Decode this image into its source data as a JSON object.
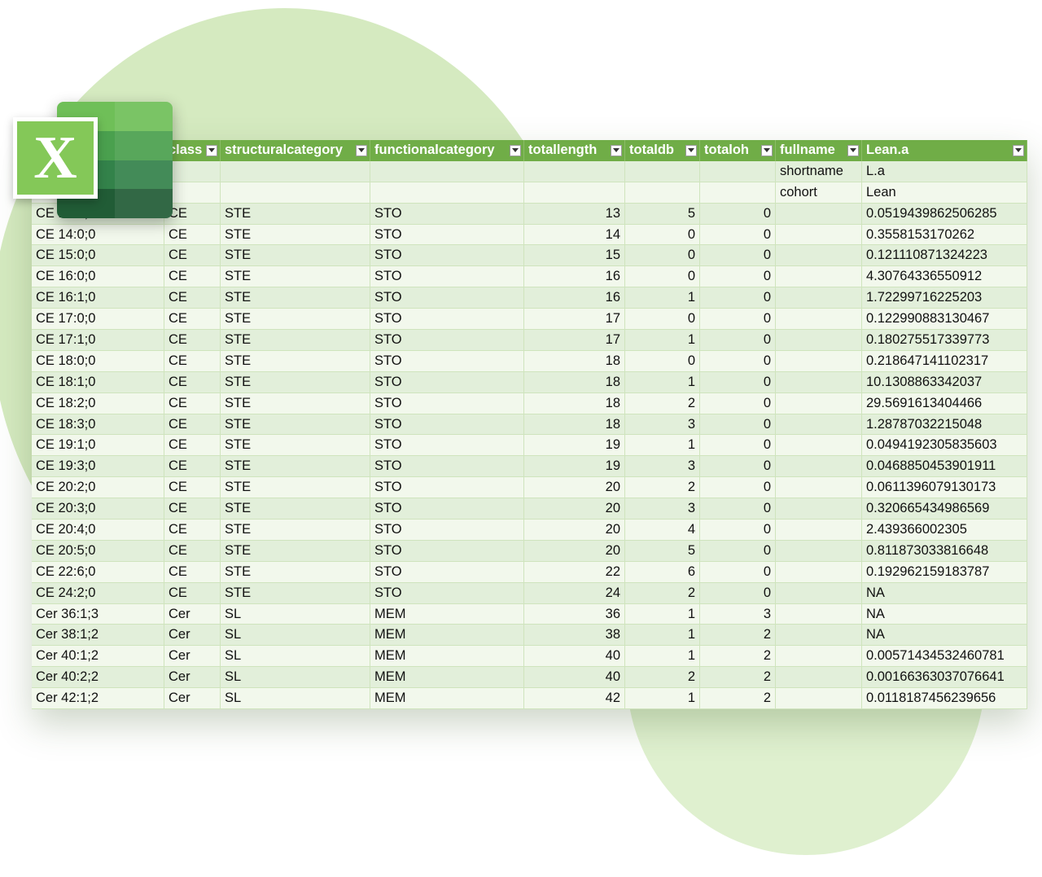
{
  "headers": [
    {
      "label": "class",
      "name": "class"
    },
    {
      "label": "structuralcategory",
      "name": "structuralcategory"
    },
    {
      "label": "functionalcategory",
      "name": "functionalcategory"
    },
    {
      "label": "totallength",
      "name": "totallength"
    },
    {
      "label": "totaldb",
      "name": "totaldb"
    },
    {
      "label": "totaloh",
      "name": "totaloh"
    },
    {
      "label": "fullname",
      "name": "fullname"
    },
    {
      "label": "Lean.a",
      "name": "lean-a"
    }
  ],
  "meta_rows": [
    {
      "label": "shortname",
      "value": "L.a"
    },
    {
      "label": "cohort",
      "value": "Lean"
    }
  ],
  "rows": [
    {
      "name": "CE 13:5;0",
      "cls": "CE",
      "sc": "STE",
      "fc": "STO",
      "len": "13",
      "db": "5",
      "oh": "0",
      "fn": "",
      "val": "0.0519439862506285"
    },
    {
      "name": "CE 14:0;0",
      "cls": "CE",
      "sc": "STE",
      "fc": "STO",
      "len": "14",
      "db": "0",
      "oh": "0",
      "fn": "",
      "val": "0.3558153170262"
    },
    {
      "name": "CE 15:0;0",
      "cls": "CE",
      "sc": "STE",
      "fc": "STO",
      "len": "15",
      "db": "0",
      "oh": "0",
      "fn": "",
      "val": "0.121110871324223"
    },
    {
      "name": "CE 16:0;0",
      "cls": "CE",
      "sc": "STE",
      "fc": "STO",
      "len": "16",
      "db": "0",
      "oh": "0",
      "fn": "",
      "val": "4.30764336550912"
    },
    {
      "name": "CE 16:1;0",
      "cls": "CE",
      "sc": "STE",
      "fc": "STO",
      "len": "16",
      "db": "1",
      "oh": "0",
      "fn": "",
      "val": "1.72299716225203"
    },
    {
      "name": "CE 17:0;0",
      "cls": "CE",
      "sc": "STE",
      "fc": "STO",
      "len": "17",
      "db": "0",
      "oh": "0",
      "fn": "",
      "val": "0.122990883130467"
    },
    {
      "name": "CE 17:1;0",
      "cls": "CE",
      "sc": "STE",
      "fc": "STO",
      "len": "17",
      "db": "1",
      "oh": "0",
      "fn": "",
      "val": "0.180275517339773"
    },
    {
      "name": "CE 18:0;0",
      "cls": "CE",
      "sc": "STE",
      "fc": "STO",
      "len": "18",
      "db": "0",
      "oh": "0",
      "fn": "",
      "val": "0.218647141102317"
    },
    {
      "name": "CE 18:1;0",
      "cls": "CE",
      "sc": "STE",
      "fc": "STO",
      "len": "18",
      "db": "1",
      "oh": "0",
      "fn": "",
      "val": "10.1308863342037"
    },
    {
      "name": "CE 18:2;0",
      "cls": "CE",
      "sc": "STE",
      "fc": "STO",
      "len": "18",
      "db": "2",
      "oh": "0",
      "fn": "",
      "val": "29.5691613404466"
    },
    {
      "name": "CE 18:3;0",
      "cls": "CE",
      "sc": "STE",
      "fc": "STO",
      "len": "18",
      "db": "3",
      "oh": "0",
      "fn": "",
      "val": "1.28787032215048"
    },
    {
      "name": "CE 19:1;0",
      "cls": "CE",
      "sc": "STE",
      "fc": "STO",
      "len": "19",
      "db": "1",
      "oh": "0",
      "fn": "",
      "val": "0.0494192305835603"
    },
    {
      "name": "CE 19:3;0",
      "cls": "CE",
      "sc": "STE",
      "fc": "STO",
      "len": "19",
      "db": "3",
      "oh": "0",
      "fn": "",
      "val": "0.0468850453901911"
    },
    {
      "name": "CE 20:2;0",
      "cls": "CE",
      "sc": "STE",
      "fc": "STO",
      "len": "20",
      "db": "2",
      "oh": "0",
      "fn": "",
      "val": "0.0611396079130173"
    },
    {
      "name": "CE 20:3;0",
      "cls": "CE",
      "sc": "STE",
      "fc": "STO",
      "len": "20",
      "db": "3",
      "oh": "0",
      "fn": "",
      "val": "0.320665434986569"
    },
    {
      "name": "CE 20:4;0",
      "cls": "CE",
      "sc": "STE",
      "fc": "STO",
      "len": "20",
      "db": "4",
      "oh": "0",
      "fn": "",
      "val": "2.439366002305"
    },
    {
      "name": "CE 20:5;0",
      "cls": "CE",
      "sc": "STE",
      "fc": "STO",
      "len": "20",
      "db": "5",
      "oh": "0",
      "fn": "",
      "val": "0.811873033816648"
    },
    {
      "name": "CE 22:6;0",
      "cls": "CE",
      "sc": "STE",
      "fc": "STO",
      "len": "22",
      "db": "6",
      "oh": "0",
      "fn": "",
      "val": "0.192962159183787"
    },
    {
      "name": "CE 24:2;0",
      "cls": "CE",
      "sc": "STE",
      "fc": "STO",
      "len": "24",
      "db": "2",
      "oh": "0",
      "fn": "",
      "val": "NA"
    },
    {
      "name": "Cer 36:1;3",
      "cls": "Cer",
      "sc": "SL",
      "fc": "MEM",
      "len": "36",
      "db": "1",
      "oh": "3",
      "fn": "",
      "val": "NA"
    },
    {
      "name": "Cer 38:1;2",
      "cls": "Cer",
      "sc": "SL",
      "fc": "MEM",
      "len": "38",
      "db": "1",
      "oh": "2",
      "fn": "",
      "val": "NA"
    },
    {
      "name": "Cer 40:1;2",
      "cls": "Cer",
      "sc": "SL",
      "fc": "MEM",
      "len": "40",
      "db": "1",
      "oh": "2",
      "fn": "",
      "val": "0.00571434532460781"
    },
    {
      "name": "Cer 40:2;2",
      "cls": "Cer",
      "sc": "SL",
      "fc": "MEM",
      "len": "40",
      "db": "2",
      "oh": "2",
      "fn": "",
      "val": "0.00166363037076641"
    },
    {
      "name": "Cer 42:1;2",
      "cls": "Cer",
      "sc": "SL",
      "fc": "MEM",
      "len": "42",
      "db": "1",
      "oh": "2",
      "fn": "",
      "val": "0.0118187456239656"
    }
  ],
  "logo": {
    "letter": "X",
    "icon": "excel-logo-icon"
  },
  "dropdown_icon": "filter-dropdown-icon",
  "colors": {
    "header": "#70ad47",
    "row_band_a": "#e2efda",
    "row_band_b": "#f2f8ec",
    "background_blob": "#d5eac0"
  }
}
